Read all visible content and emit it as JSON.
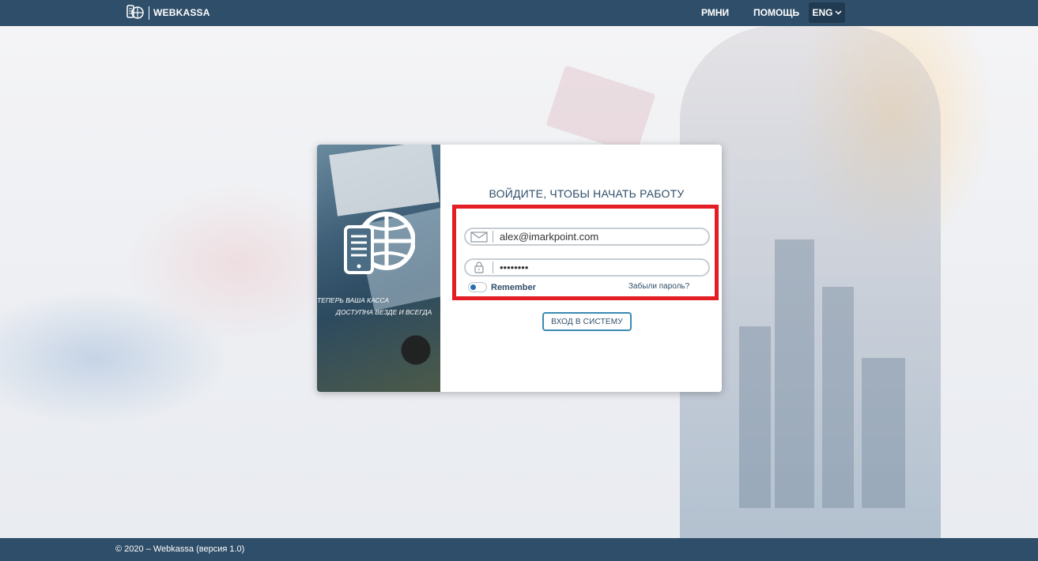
{
  "header": {
    "brand_name": "WEBKASSA",
    "nav": [
      "РМНИ",
      "ПОМОЩЬ"
    ],
    "language": "ENG"
  },
  "promo": {
    "line1": "ТЕПЕРЬ ВАША КАССА",
    "line2": "ДОСТУПНА ВЕЗДЕ И ВСЕГДА"
  },
  "login": {
    "title": "ВОЙДИТЕ, ЧТОБЫ НАЧАТЬ РАБОТУ",
    "email_value": "alex@imarkpoint.com",
    "password_value": "••••••••",
    "remember_label": "Remember",
    "remember_checked": true,
    "forgot_label": "Забыли пароль?",
    "submit_label": "ВХОД В СИСТЕМУ"
  },
  "footer": {
    "text": "© 2020 – Webkassa (версия 1.0)"
  },
  "colors": {
    "header_bg": "#2f4e69",
    "highlight": "#e31e24",
    "accent": "#3a8ab3"
  }
}
